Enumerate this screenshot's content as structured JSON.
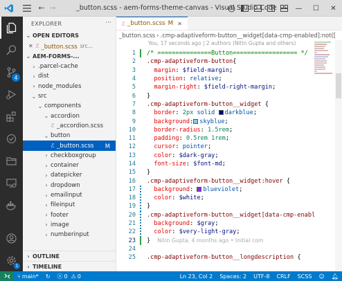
{
  "window": {
    "title": "_button.scss - aem-forms-theme-canvas - Visual Studio Code"
  },
  "sidebar": {
    "title": "EXPLORER",
    "open_editors": {
      "header": "OPEN EDITORS",
      "items": [
        {
          "name": "_button.scss",
          "path": "src..."
        }
      ]
    },
    "project": {
      "header": "AEM-FORMS-...",
      "tree": [
        {
          "label": ".parcel-cache",
          "indent": 0,
          "chevron": "right",
          "selected": false,
          "mark": ""
        },
        {
          "label": "dist",
          "indent": 0,
          "chevron": "right",
          "selected": false,
          "mark": ""
        },
        {
          "label": "node_modules",
          "indent": 0,
          "chevron": "right",
          "selected": false,
          "mark": ""
        },
        {
          "label": "src",
          "indent": 0,
          "chevron": "down",
          "selected": false,
          "mark": ""
        },
        {
          "label": "components",
          "indent": 1,
          "chevron": "down",
          "selected": false,
          "mark": ""
        },
        {
          "label": "accordion",
          "indent": 2,
          "chevron": "down",
          "selected": false,
          "mark": ""
        },
        {
          "label": "_accordion.scss",
          "indent": 3,
          "chevron": "",
          "selected": false,
          "mark": ""
        },
        {
          "label": "button",
          "indent": 2,
          "chevron": "down",
          "selected": false,
          "mark": ""
        },
        {
          "label": "_button.scss",
          "indent": 3,
          "chevron": "",
          "selected": true,
          "mark": "M"
        },
        {
          "label": "checkboxgroup",
          "indent": 2,
          "chevron": "right",
          "selected": false,
          "mark": ""
        },
        {
          "label": "container",
          "indent": 2,
          "chevron": "right",
          "selected": false,
          "mark": ""
        },
        {
          "label": "datepicker",
          "indent": 2,
          "chevron": "right",
          "selected": false,
          "mark": ""
        },
        {
          "label": "dropdown",
          "indent": 2,
          "chevron": "right",
          "selected": false,
          "mark": ""
        },
        {
          "label": "emailinput",
          "indent": 2,
          "chevron": "right",
          "selected": false,
          "mark": ""
        },
        {
          "label": "fileinput",
          "indent": 2,
          "chevron": "right",
          "selected": false,
          "mark": ""
        },
        {
          "label": "footer",
          "indent": 2,
          "chevron": "right",
          "selected": false,
          "mark": ""
        },
        {
          "label": "image",
          "indent": 2,
          "chevron": "right",
          "selected": false,
          "mark": ""
        },
        {
          "label": "numberinput",
          "indent": 2,
          "chevron": "right",
          "selected": false,
          "mark": ""
        }
      ]
    },
    "outline_header": "OUTLINE",
    "timeline_header": "TIMELINE"
  },
  "activity_bar": {
    "scm_badge": "4"
  },
  "editor": {
    "tab": {
      "name": "_button.scss",
      "modified": "M"
    },
    "breadcrumb": [
      "_button.scss",
      ".cmp-adaptiveform-button__widget[data-cmp-enabled]:not(["
    ],
    "blame": "You, 17 seconds ago | 2 authors (Nitin Gupta and others)",
    "lines": [
      {
        "n": "1",
        "tokens": [
          [
            "c-comment",
            "/* ===============Button================== */"
          ]
        ]
      },
      {
        "n": "2",
        "tokens": [
          [
            "c-sel",
            ".cmp-adaptiveform-button"
          ],
          [
            "c-punc",
            "{"
          ]
        ]
      },
      {
        "n": "3",
        "tokens": [
          [
            "c-prop",
            "  margin"
          ],
          [
            "c-punc",
            ": "
          ],
          [
            "c-var",
            "$field-margin"
          ],
          [
            "c-punc",
            ";"
          ]
        ]
      },
      {
        "n": "4",
        "tokens": [
          [
            "c-prop",
            "  position"
          ],
          [
            "c-punc",
            ": "
          ],
          [
            "c-val",
            "relative"
          ],
          [
            "c-punc",
            ";"
          ]
        ]
      },
      {
        "n": "5",
        "tokens": [
          [
            "c-prop",
            "  margin-right"
          ],
          [
            "c-punc",
            ": "
          ],
          [
            "c-var",
            "$field-right-margin"
          ],
          [
            "c-punc",
            ";"
          ]
        ]
      },
      {
        "n": "6",
        "tokens": [
          [
            "c-punc",
            "}"
          ]
        ]
      },
      {
        "n": "7",
        "tokens": [
          [
            "c-sel",
            ".cmp-adaptiveform-button__widget"
          ],
          [
            "c-punc",
            " {"
          ]
        ]
      },
      {
        "n": "8",
        "tokens": [
          [
            "c-prop",
            "  border"
          ],
          [
            "c-punc",
            ": "
          ],
          [
            "c-num",
            "2px"
          ],
          [
            "c-val",
            " solid "
          ],
          [
            "swatch:#00008b",
            ""
          ],
          [
            "c-val",
            "darkblue"
          ],
          [
            "c-punc",
            ";"
          ]
        ]
      },
      {
        "n": "9",
        "tokens": [
          [
            "c-prop",
            "  background"
          ],
          [
            "c-punc",
            ":"
          ],
          [
            "swatch:#87ceeb",
            ""
          ],
          [
            "c-val",
            "skyblue"
          ],
          [
            "c-punc",
            ";"
          ]
        ]
      },
      {
        "n": "10",
        "tokens": [
          [
            "c-prop",
            "  border-radius"
          ],
          [
            "c-punc",
            ": "
          ],
          [
            "c-num",
            "1.5rem"
          ],
          [
            "c-punc",
            ";"
          ]
        ]
      },
      {
        "n": "11",
        "tokens": [
          [
            "c-prop",
            "  padding"
          ],
          [
            "c-punc",
            ": "
          ],
          [
            "c-num",
            "0.5rem 1rem"
          ],
          [
            "c-punc",
            ";"
          ]
        ]
      },
      {
        "n": "12",
        "tokens": [
          [
            "c-prop",
            "  cursor"
          ],
          [
            "c-punc",
            ": "
          ],
          [
            "c-val",
            "pointer"
          ],
          [
            "c-punc",
            ";"
          ]
        ]
      },
      {
        "n": "13",
        "tokens": [
          [
            "c-prop",
            "  color"
          ],
          [
            "c-punc",
            ": "
          ],
          [
            "c-var",
            "$dark-gray"
          ],
          [
            "c-punc",
            ";"
          ]
        ]
      },
      {
        "n": "14",
        "tokens": [
          [
            "c-prop",
            "  font-size"
          ],
          [
            "c-punc",
            ": "
          ],
          [
            "c-var",
            "$font-md"
          ],
          [
            "c-punc",
            ";"
          ]
        ]
      },
      {
        "n": "15",
        "tokens": [
          [
            "c-punc",
            "}"
          ]
        ]
      },
      {
        "n": "16",
        "tokens": [
          [
            "c-sel",
            ".cmp-adaptiveform-button__widget:hover"
          ],
          [
            "c-punc",
            " {"
          ]
        ]
      },
      {
        "n": "17",
        "tokens": [
          [
            "c-prop",
            "  background"
          ],
          [
            "c-punc",
            ": "
          ],
          [
            "swatch:#8a2be2",
            ""
          ],
          [
            "c-val",
            "blueviolet"
          ],
          [
            "c-punc",
            ";"
          ]
        ]
      },
      {
        "n": "18",
        "tokens": [
          [
            "c-prop",
            "  color"
          ],
          [
            "c-punc",
            ": "
          ],
          [
            "c-var",
            "$white"
          ],
          [
            "c-punc",
            ";"
          ]
        ]
      },
      {
        "n": "19",
        "tokens": [
          [
            "c-punc",
            "}"
          ]
        ]
      },
      {
        "n": "20",
        "tokens": [
          [
            "c-sel",
            ".cmp-adaptiveform-button__widget[data-cmp-enabl"
          ]
        ]
      },
      {
        "n": "21",
        "tokens": [
          [
            "c-prop",
            "  background"
          ],
          [
            "c-punc",
            ": "
          ],
          [
            "c-var",
            "$gray"
          ],
          [
            "c-punc",
            ";"
          ]
        ]
      },
      {
        "n": "22",
        "tokens": [
          [
            "c-prop",
            "  color"
          ],
          [
            "c-punc",
            ": "
          ],
          [
            "c-var",
            "$very-light-gray"
          ],
          [
            "c-punc",
            ";"
          ]
        ]
      },
      {
        "n": "23",
        "tokens": [
          [
            "c-punc",
            "}"
          ],
          [
            "c-ghost",
            "Nitin Gupta, 4 months ago • Initial com"
          ]
        ]
      },
      {
        "n": "24",
        "tokens": [
          [
            "c-punc",
            ""
          ]
        ]
      },
      {
        "n": "25",
        "tokens": [
          [
            "c-sel",
            ".cmp-adaptiveform-button__longdescription"
          ],
          [
            "c-punc",
            " {"
          ]
        ]
      }
    ],
    "current_line": "23",
    "modified_lines": [
      "1",
      "17",
      "18",
      "19",
      "20",
      "21",
      "22",
      "23"
    ]
  },
  "statusbar": {
    "branch": "main*",
    "sync": "↻",
    "errors": "0",
    "warnings": "0",
    "position": "Ln 23, Col 2",
    "spaces": "Spaces: 2",
    "encoding": "UTF-8",
    "eol": "CRLF",
    "language": "SCSS"
  }
}
